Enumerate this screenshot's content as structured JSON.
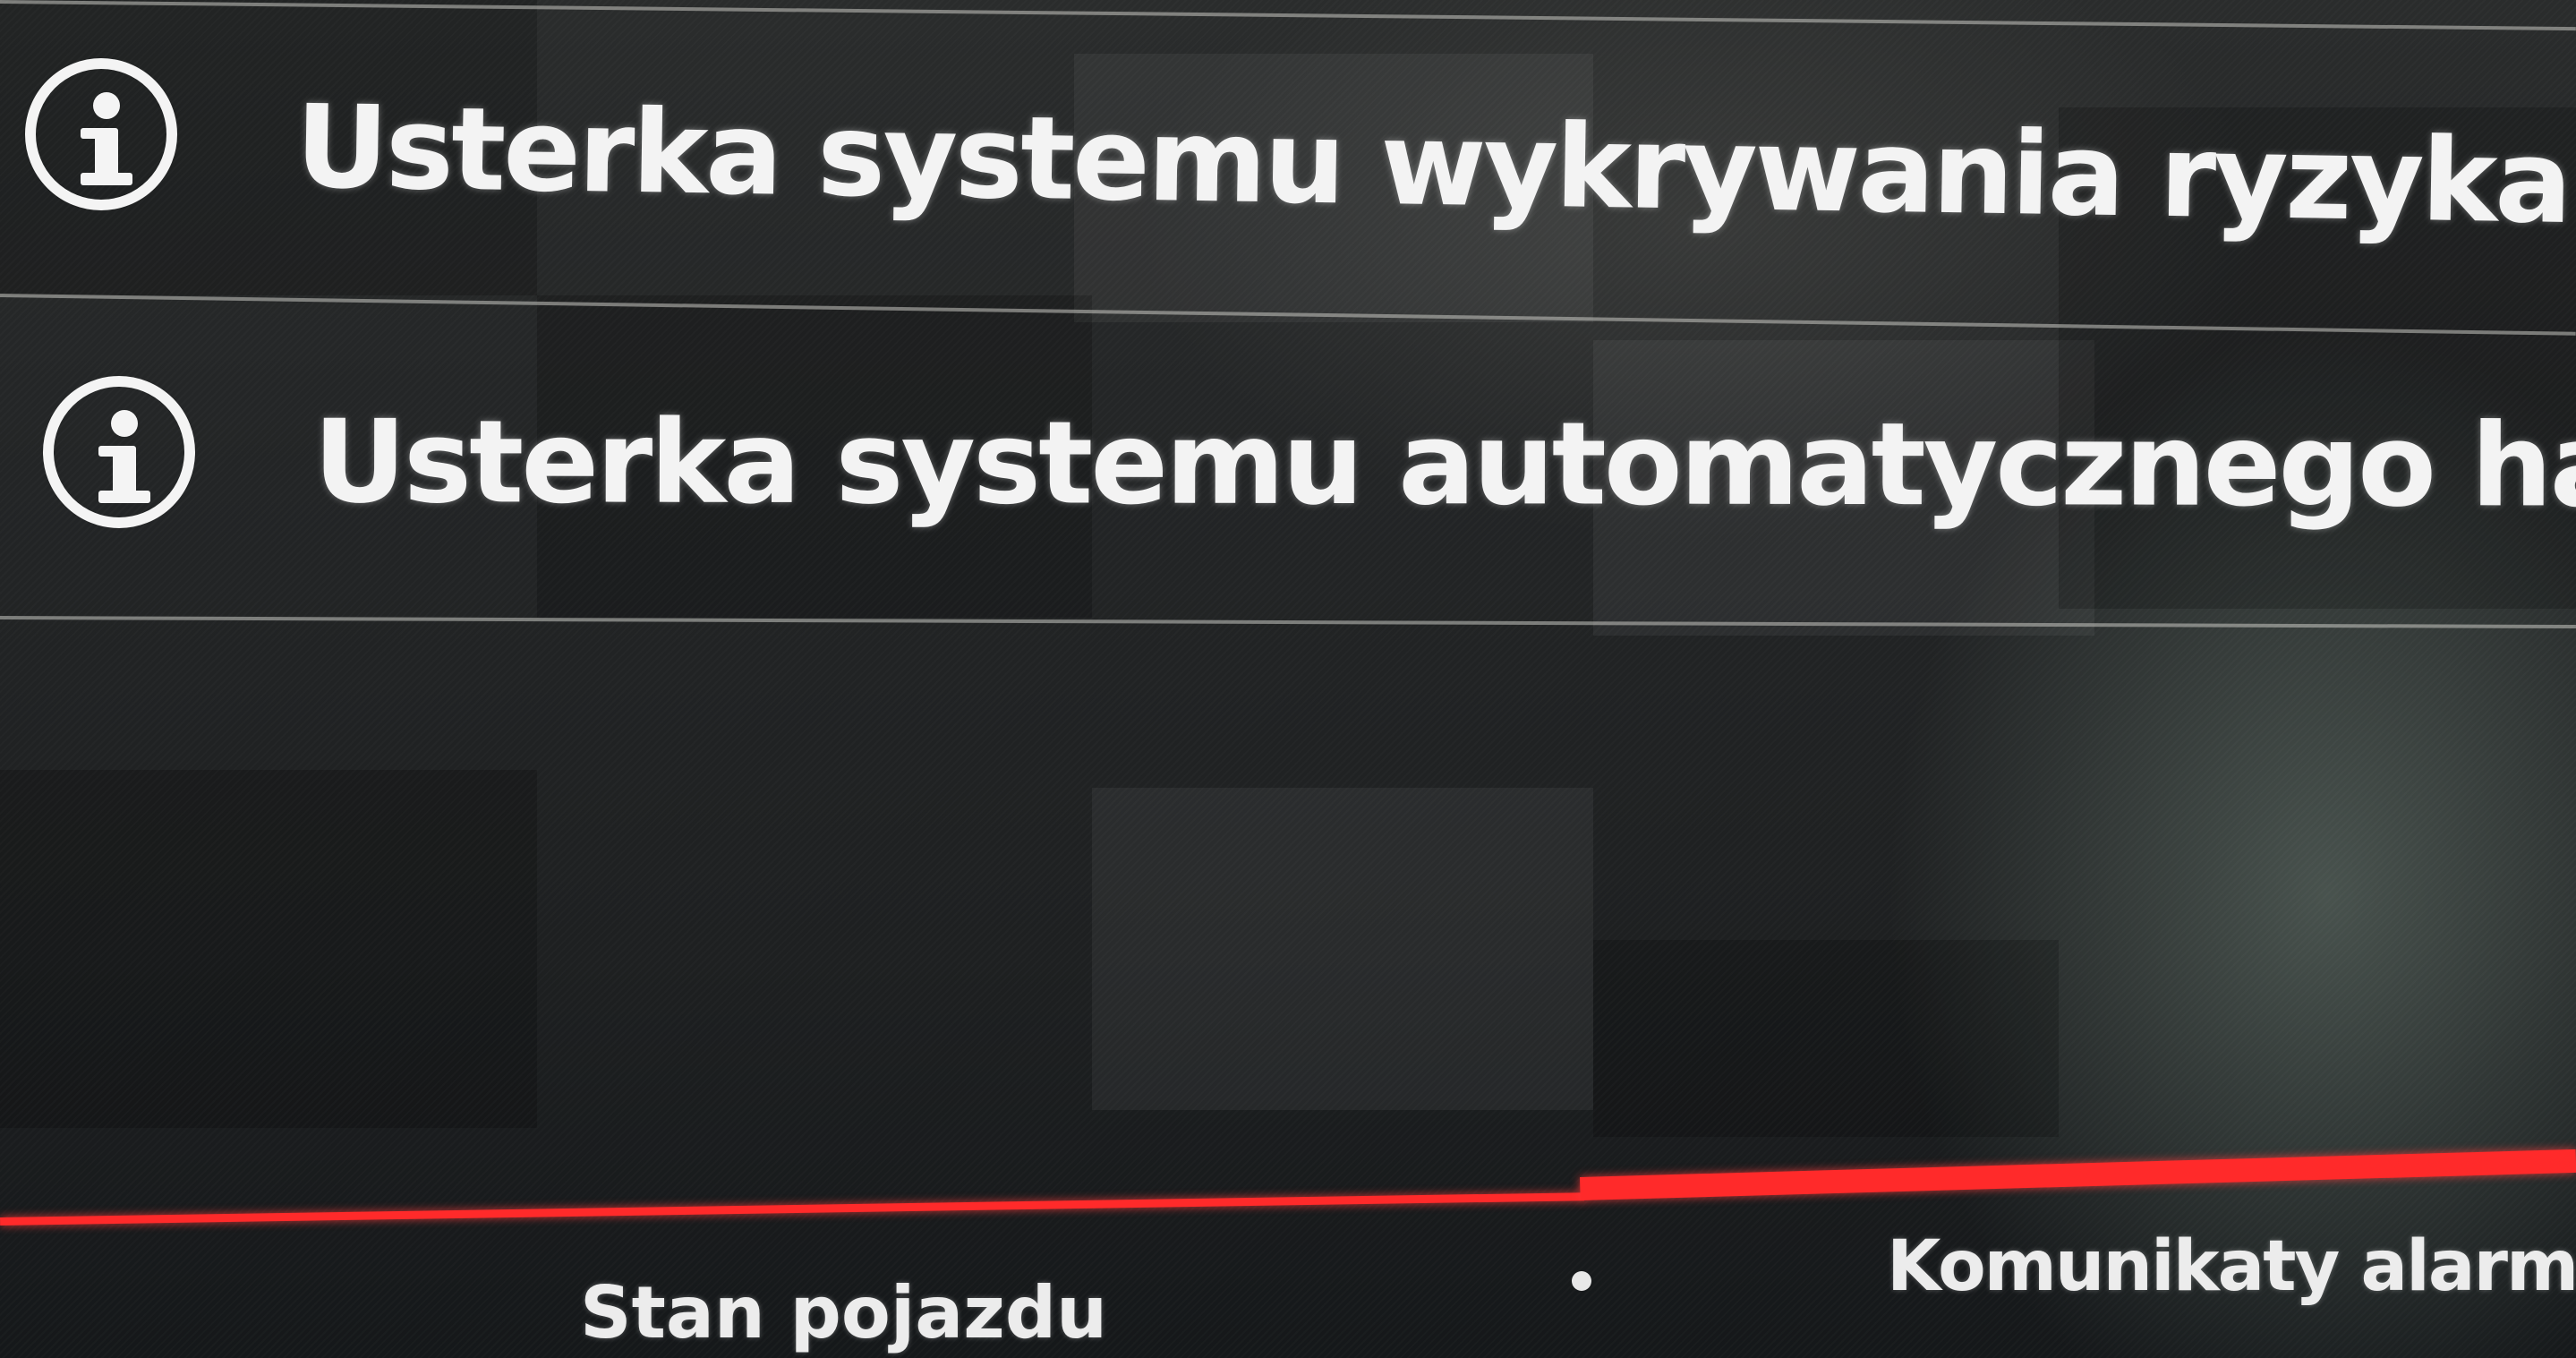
{
  "messages": [
    {
      "icon": "info-icon",
      "text": "Usterka systemu wykrywania ryzyka zderzenia"
    },
    {
      "icon": "info-icon",
      "text": "Usterka systemu automatycznego hamowania"
    }
  ],
  "tabs": {
    "left": "Stan pojazdu",
    "right": "Komunikaty alarmow"
  },
  "colors": {
    "background": "#1c1e1f",
    "text": "#f3f3f3",
    "active_tab_indicator": "#ff2a2a"
  }
}
